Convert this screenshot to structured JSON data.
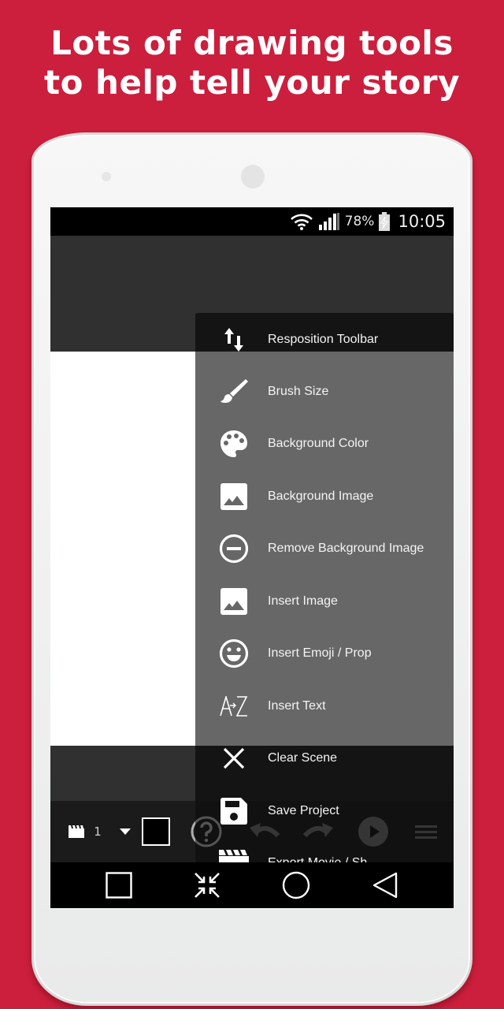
{
  "headline": {
    "line1": "Lots of drawing tools",
    "line2": "to help tell your story"
  },
  "status_bar": {
    "wifi_icon": "wifi-icon",
    "signal_icon": "cell-signal-icon",
    "battery_percent": "78%",
    "battery_icon": "battery-charging-icon",
    "time": "10:05"
  },
  "menu": {
    "items": [
      {
        "label": "Resposition Toolbar",
        "icon": "reposition-arrows-icon"
      },
      {
        "label": "Brush Size",
        "icon": "brush-icon"
      },
      {
        "label": "Background Color",
        "icon": "palette-icon"
      },
      {
        "label": "Background Image",
        "icon": "image-icon"
      },
      {
        "label": "Remove Background Image",
        "icon": "remove-circle-icon"
      },
      {
        "label": "Insert Image",
        "icon": "image-icon"
      },
      {
        "label": "Insert Emoji / Prop",
        "icon": "smiley-icon"
      },
      {
        "label": "Insert Text",
        "icon": "text-az-icon"
      },
      {
        "label": "Clear Scene",
        "icon": "close-x-icon"
      },
      {
        "label": "Save Project",
        "icon": "save-floppy-icon"
      },
      {
        "label": "Export Movie / Sh",
        "icon": "clapperboard-icon"
      }
    ]
  },
  "toolbar": {
    "scene_number": "1",
    "current_color": "#000000",
    "icons": [
      "clapperboard-icon",
      "dropdown-arrow-icon",
      "color-swatch",
      "help-icon",
      "undo-icon",
      "redo-icon",
      "play-icon",
      "hamburger-menu-icon"
    ]
  },
  "nav_bar": {
    "icons": [
      "recent-apps-icon",
      "exit-fullscreen-icon",
      "home-icon",
      "back-icon"
    ]
  },
  "colors": {
    "background": "#cb1f3d",
    "menu_highlight": "#141414",
    "menu_body": "#676767",
    "canvas": "#ffffff"
  }
}
